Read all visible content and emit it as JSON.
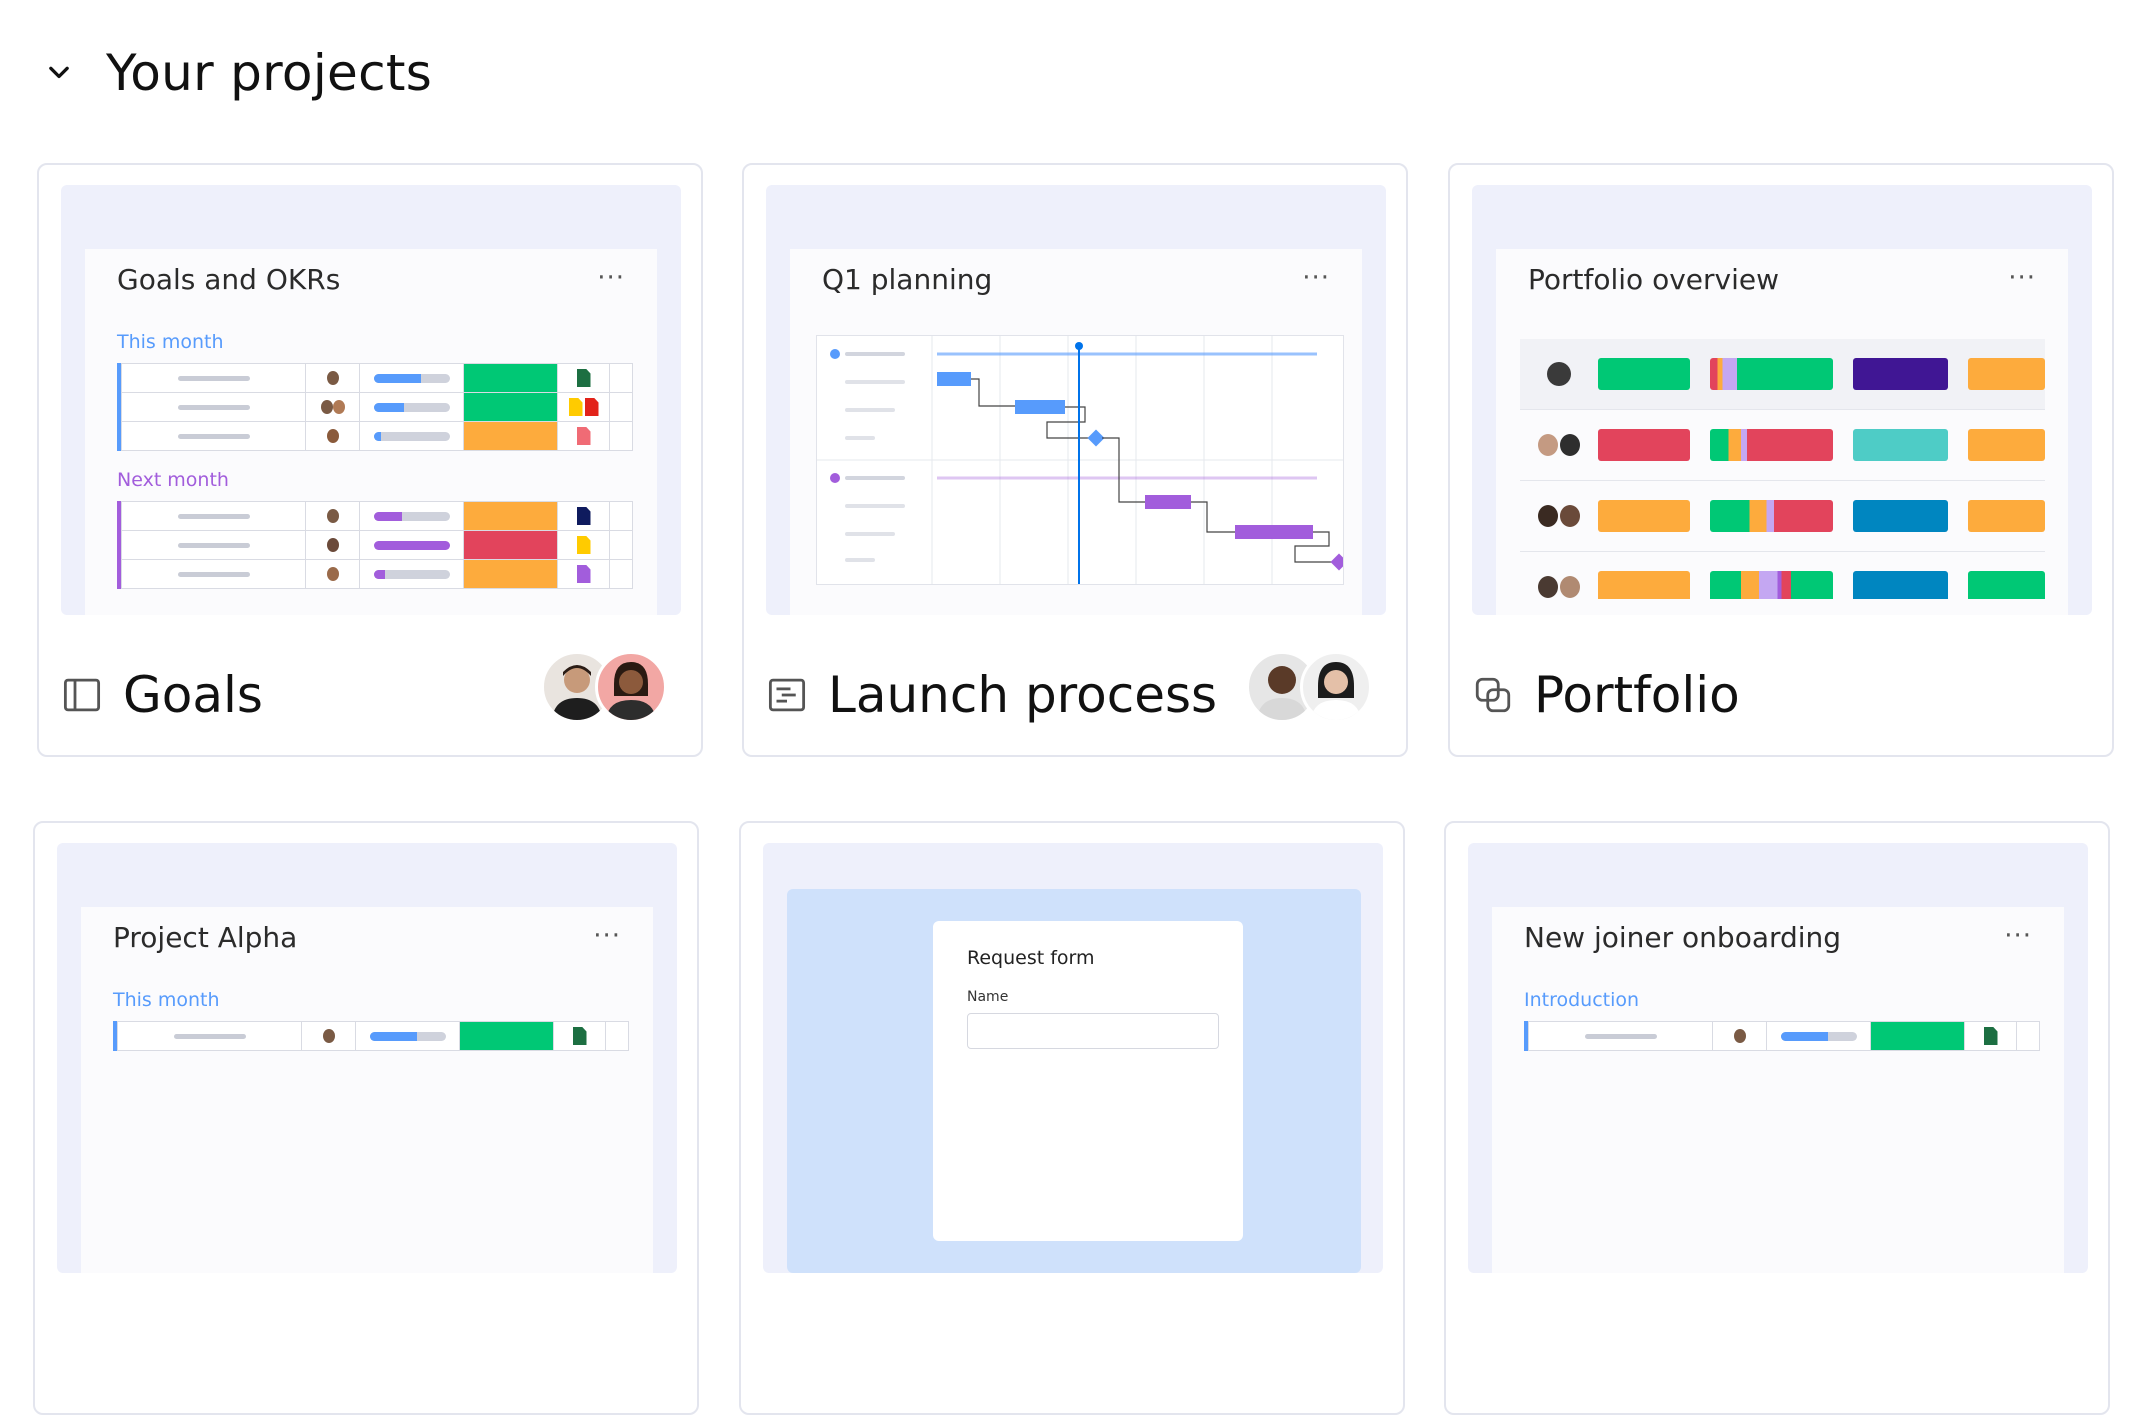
{
  "section": {
    "title": "Your projects",
    "toggle_icon": "chevron-down-icon"
  },
  "colors": {
    "green": "#00c875",
    "orange": "#fdab3d",
    "red": "#e2445c",
    "purple": "#a25ddc",
    "blue": "#579bfc",
    "dark_purple": "#401694",
    "teal": "#4eccc6",
    "dark_blue": "#0086c0",
    "this_month": "#579bfc",
    "next_month": "#a25ddc"
  },
  "cards": [
    {
      "name": "Goals",
      "icon": "board-icon",
      "preview_title": "Goals and OKRs",
      "group1": "This month",
      "group2": "Next month",
      "menu": "···"
    },
    {
      "name": "Launch process",
      "icon": "gantt-icon",
      "preview_title": "Q1 planning",
      "menu": "···"
    },
    {
      "name": "Portfolio",
      "icon": "portfolio-icon",
      "preview_title": "Portfolio overview",
      "menu": "···"
    },
    {
      "name": "",
      "icon": "board-icon",
      "preview_title": "Project Alpha",
      "group1": "This month",
      "menu": "···"
    },
    {
      "name": "",
      "icon": "form-icon",
      "preview_title": "Request form",
      "field_label": "Name"
    },
    {
      "name": "",
      "icon": "board-icon",
      "preview_title": "New joiner onboarding",
      "group1": "Introduction",
      "menu": "···"
    }
  ]
}
